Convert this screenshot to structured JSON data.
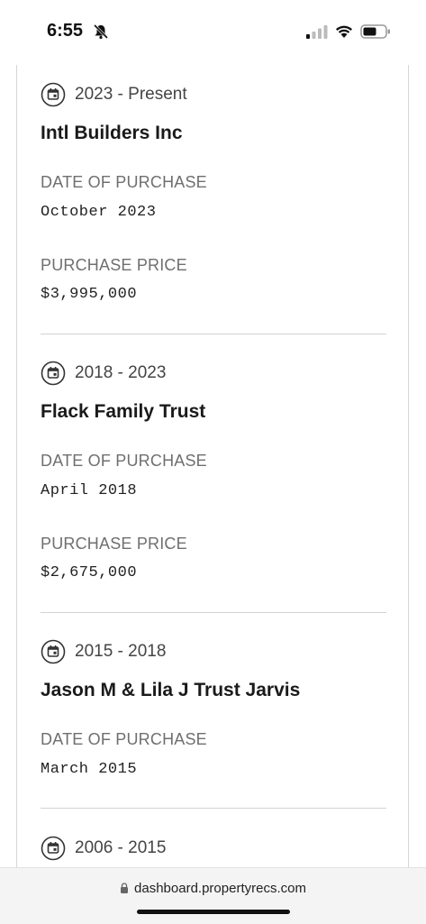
{
  "status_bar": {
    "time": "6:55",
    "icons": [
      "bell-slash-icon",
      "cellular-signal-icon",
      "wifi-icon",
      "battery-icon"
    ]
  },
  "history": [
    {
      "period": "2023 - Present",
      "owner": "Intl Builders Inc",
      "date_label": "DATE OF PURCHASE",
      "date": "October 2023",
      "price_label": "PURCHASE PRICE",
      "price": "$3,995,000"
    },
    {
      "period": "2018 - 2023",
      "owner": "Flack Family Trust",
      "date_label": "DATE OF PURCHASE",
      "date": "April 2018",
      "price_label": "PURCHASE PRICE",
      "price": "$2,675,000"
    },
    {
      "period": "2015 - 2018",
      "owner": "Jason M & Lila J Trust Jarvis",
      "date_label": "DATE OF PURCHASE",
      "date": "March 2015"
    },
    {
      "period": "2006 - 2015"
    }
  ],
  "browser": {
    "url": "dashboard.propertyrecs.com"
  },
  "colors": {
    "divider": "#d3d3d3",
    "label": "#6f6f6f",
    "text": "#1a1a1a"
  }
}
